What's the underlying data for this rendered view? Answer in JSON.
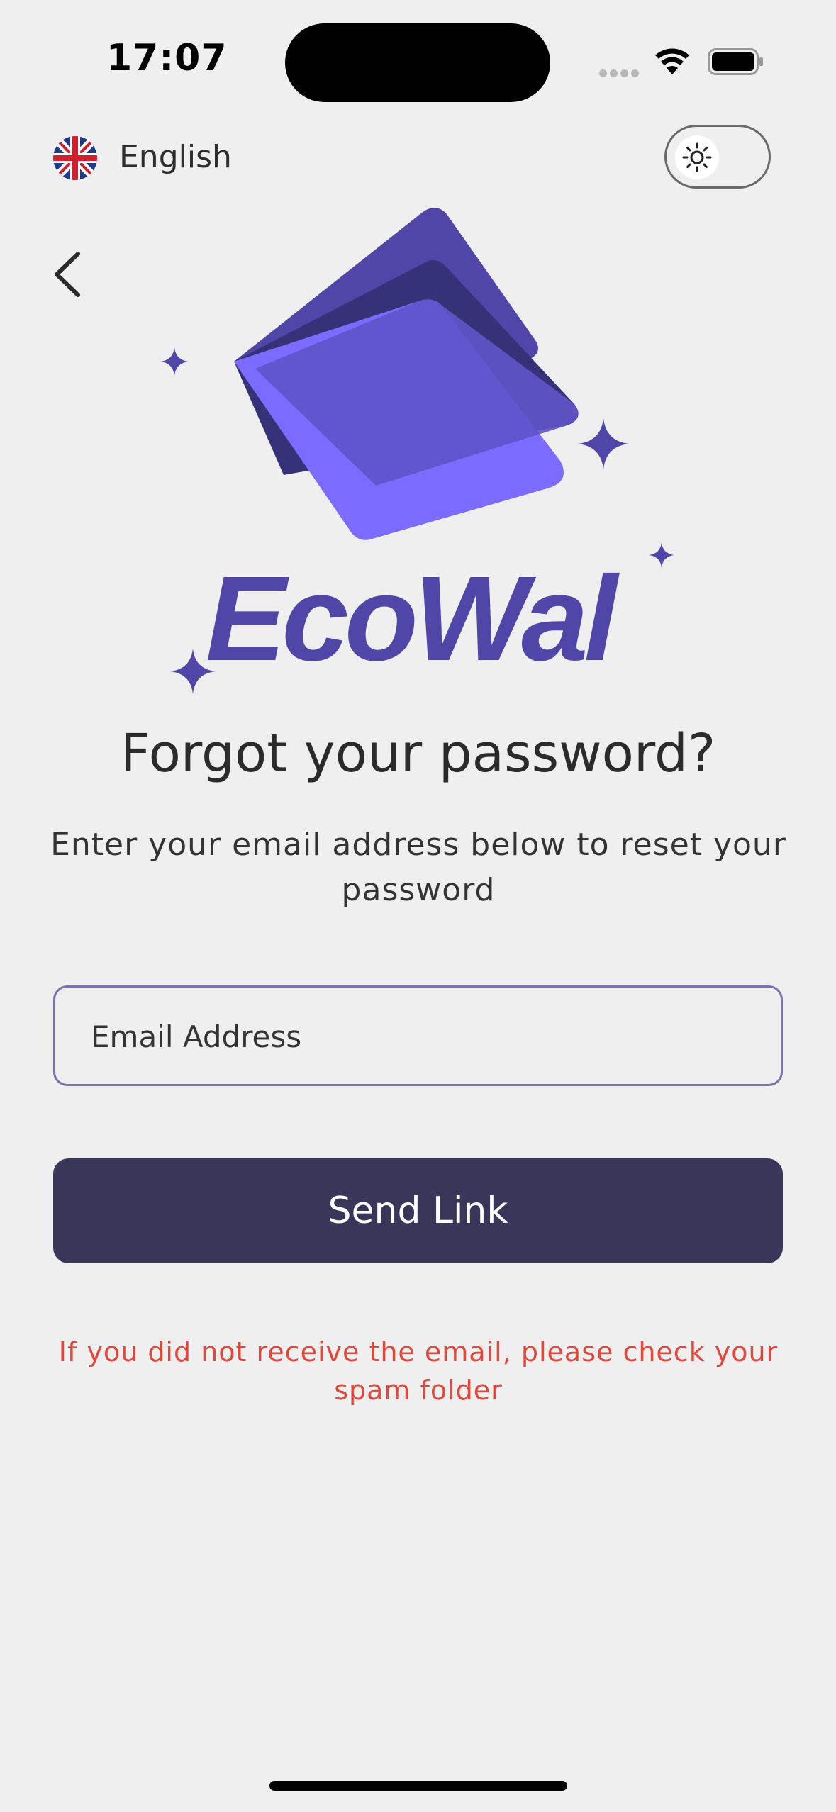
{
  "status_bar": {
    "time": "17:07"
  },
  "language": {
    "label": "English",
    "flag": "uk-flag-icon"
  },
  "theme": {
    "mode": "light",
    "icon": "sun-icon"
  },
  "back": {
    "icon": "chevron-left-icon"
  },
  "logo": {
    "brand": "EcoWal",
    "colors": {
      "primary": "#4f46a8",
      "dark": "#363278",
      "light": "#7b6cff"
    }
  },
  "page": {
    "title": "Forgot your password?",
    "subtitle": "Enter your email address below to reset your password"
  },
  "form": {
    "email_placeholder": "Email Address",
    "email_value": "",
    "submit_label": "Send Link"
  },
  "note": "If you did not receive the email, please check your spam folder",
  "colors": {
    "background": "#efefef",
    "button": "#383759",
    "warning": "#e2473b",
    "field_border": "#7a72b3"
  }
}
